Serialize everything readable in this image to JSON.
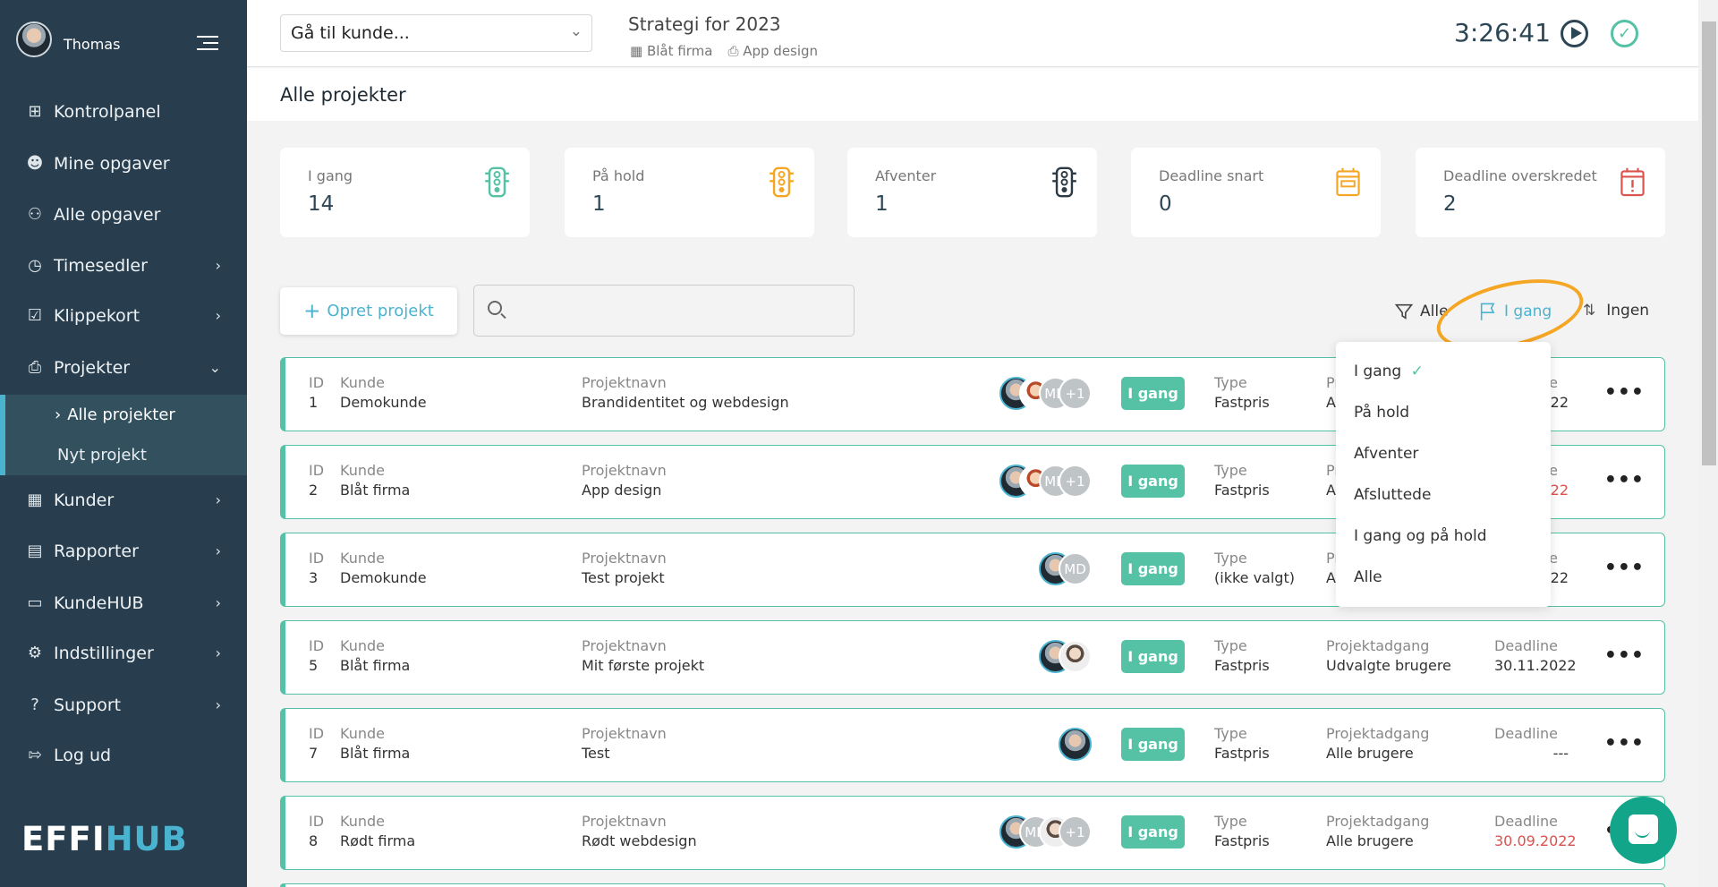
{
  "user": {
    "name": "Thomas"
  },
  "sidebar": {
    "items": [
      {
        "label": "Kontrolpanel",
        "icon": "dashboard-icon"
      },
      {
        "label": "Mine opgaver",
        "icon": "user-icon"
      },
      {
        "label": "Alle opgaver",
        "icon": "users-icon"
      },
      {
        "label": "Timesedler",
        "icon": "clock-icon",
        "chevron": true
      },
      {
        "label": "Klippekort",
        "icon": "checkbox-icon",
        "chevron": true
      },
      {
        "label": "Projekter",
        "icon": "clipboard-icon",
        "expanded": true
      },
      {
        "label": "Kunder",
        "icon": "building-icon",
        "chevron": true
      },
      {
        "label": "Rapporter",
        "icon": "chart-icon",
        "chevron": true
      },
      {
        "label": "KundeHUB",
        "icon": "monitor-icon",
        "chevron": true
      },
      {
        "label": "Indstillinger",
        "icon": "gear-icon",
        "chevron": true
      },
      {
        "label": "Support",
        "icon": "help-icon",
        "chevron": true
      },
      {
        "label": "Log ud",
        "icon": "logout-icon"
      }
    ],
    "subitems": [
      {
        "label": "Alle projekter",
        "active": true
      },
      {
        "label": "Nyt projekt"
      }
    ],
    "logo": {
      "part1": "EFFI",
      "part2": "HUB"
    }
  },
  "topbar": {
    "customer_select": "Gå til kunde...",
    "project_title": "Strategi for 2023",
    "project_customer": "Blåt firma",
    "project_name": "App design",
    "timer": "3:26:41"
  },
  "page": {
    "title": "Alle projekter"
  },
  "stats": [
    {
      "label": "I gang",
      "value": "14",
      "color": "#55c1a5",
      "icon": "traffic-light-icon"
    },
    {
      "label": "På hold",
      "value": "1",
      "color": "#f5a623",
      "icon": "traffic-light-icon"
    },
    {
      "label": "Afventer",
      "value": "1",
      "color": "#2d3a44",
      "icon": "traffic-light-icon"
    },
    {
      "label": "Deadline snart",
      "value": "0",
      "color": "#f5a623",
      "icon": "calendar-icon"
    },
    {
      "label": "Deadline overskredet",
      "value": "2",
      "color": "#d9534f",
      "icon": "calendar-alert-icon"
    }
  ],
  "toolbar": {
    "new_project": "Opret projekt",
    "search_placeholder": "",
    "filter_all": "Alle",
    "filter_status": "I gang",
    "sort": "Ingen"
  },
  "labels": {
    "id": "ID",
    "customer": "Kunde",
    "name": "Projektnavn",
    "type": "Type",
    "access": "Projektadgang",
    "deadline": "Deadline"
  },
  "projects": [
    {
      "id": "1",
      "customer": "Demokunde",
      "name": "Brandidentitet og webdesign",
      "status": "I gang",
      "type": "Fastpris",
      "access": "A",
      "deadline": "22",
      "deadline_overdue": false,
      "avatars": [
        "me",
        "cartoon",
        "MD",
        "+1"
      ]
    },
    {
      "id": "2",
      "customer": "Blåt firma",
      "name": "App design",
      "status": "I gang",
      "type": "Fastpris",
      "access": "A",
      "deadline": "22",
      "deadline_overdue": true,
      "avatars": [
        "me",
        "cartoon",
        "MD",
        "+1"
      ]
    },
    {
      "id": "3",
      "customer": "Demokunde",
      "name": "Test projekt",
      "status": "I gang",
      "type": "(ikke valgt)",
      "access": "A",
      "deadline": "22",
      "deadline_overdue": false,
      "avatars": [
        "me",
        "MD"
      ]
    },
    {
      "id": "5",
      "customer": "Blåt firma",
      "name": "Mit første projekt",
      "status": "I gang",
      "type": "Fastpris",
      "access": "Udvalgte brugere",
      "deadline": "30.11.2022",
      "deadline_overdue": false,
      "avatars": [
        "me",
        "woman"
      ]
    },
    {
      "id": "7",
      "customer": "Blåt firma",
      "name": "Test",
      "status": "I gang",
      "type": "Fastpris",
      "access": "Alle brugere",
      "deadline": "---",
      "deadline_overdue": false,
      "avatars": [
        "me"
      ]
    },
    {
      "id": "8",
      "customer": "Rødt firma",
      "name": "Rødt webdesign",
      "status": "I gang",
      "type": "Fastpris",
      "access": "Alle brugere",
      "deadline": "30.09.2022",
      "deadline_overdue": true,
      "avatars": [
        "me",
        "MD",
        "woman",
        "+1"
      ]
    }
  ],
  "status_dropdown": {
    "options": [
      "I gang",
      "På hold",
      "Afventer",
      "Afsluttede",
      "I gang og på hold",
      "Alle"
    ],
    "selected": "I gang"
  },
  "colors": {
    "sidebar": "#283e4e",
    "accent": "#55c1a5",
    "link": "#4ab3cf",
    "highlight": "#f5a623",
    "overdue": "#d9534f"
  }
}
